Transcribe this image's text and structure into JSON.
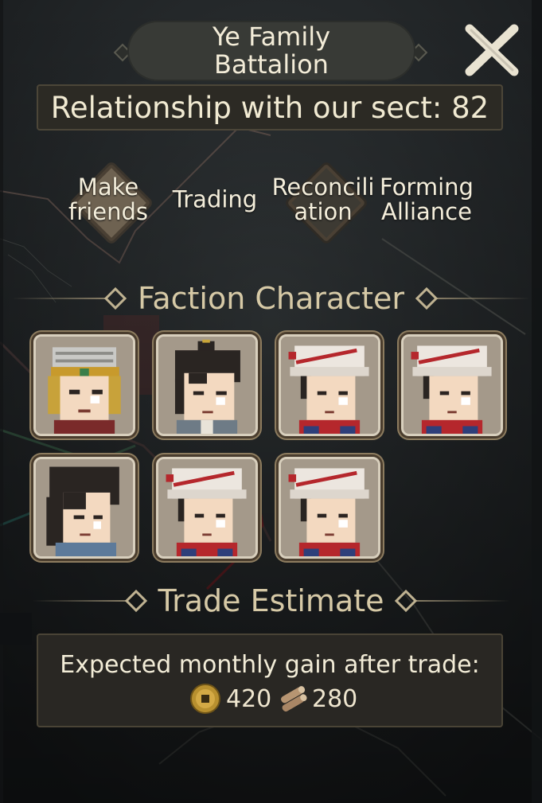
{
  "header": {
    "title_line1": "Ye Family",
    "title_line2": "Battalion",
    "close_icon": "close-icon"
  },
  "relationship": {
    "text": "Relationship with our sect: 82",
    "value": 82
  },
  "actions": [
    {
      "line1": "Make",
      "line2": "friends",
      "icon": "diamond-badge-icon"
    },
    {
      "line1": "Trading",
      "line2": "",
      "icon": ""
    },
    {
      "line1": "Reconcili",
      "line2": "ation",
      "icon": "diamond-badge-icon"
    },
    {
      "line1": "Forming",
      "line2": "Alliance",
      "icon": ""
    }
  ],
  "sections": {
    "faction_character": "Faction Character",
    "trade_estimate": "Trade Estimate"
  },
  "characters": [
    {
      "icon": "gold-helmet-warrior-portrait"
    },
    {
      "icon": "topknot-swordsman-portrait"
    },
    {
      "icon": "white-cap-soldier-portrait"
    },
    {
      "icon": "white-cap-soldier-portrait"
    },
    {
      "icon": "long-hair-fighter-portrait"
    },
    {
      "icon": "white-cap-soldier-portrait"
    },
    {
      "icon": "white-cap-soldier-portrait"
    }
  ],
  "trade": {
    "label": "Expected monthly gain after trade:",
    "coins": "420",
    "wood": "280",
    "coin_icon": "coin-icon",
    "wood_icon": "wood-log-icon"
  },
  "colors": {
    "panel": "#24282a",
    "text": "#efe6cf",
    "accent": "#d6c9a6",
    "diamond": "#6e6251"
  }
}
